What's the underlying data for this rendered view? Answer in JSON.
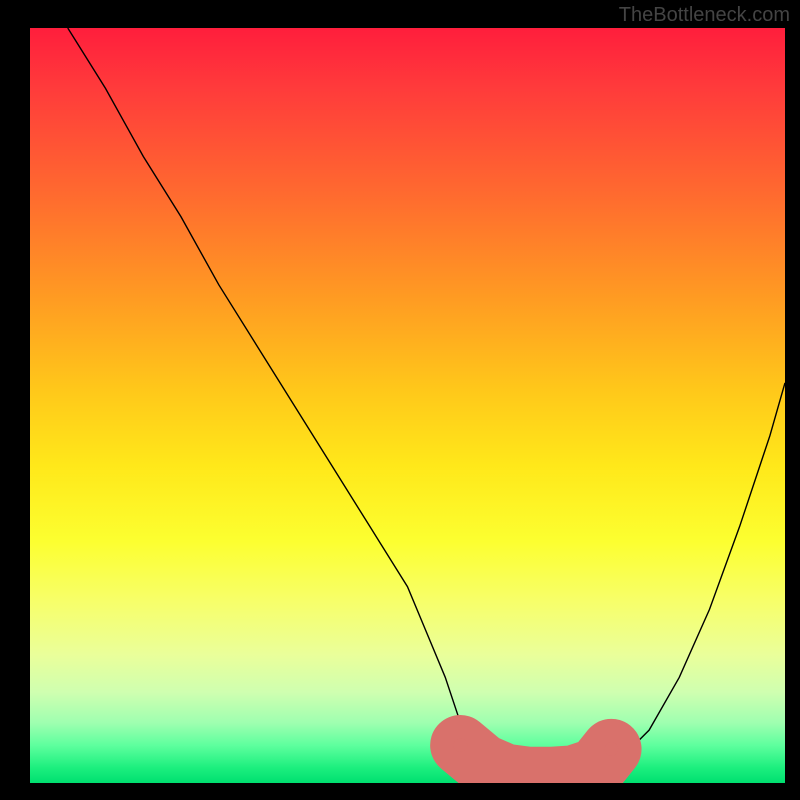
{
  "watermark": "TheBottleneck.com",
  "chart_data": {
    "type": "line",
    "title": "",
    "xlabel": "",
    "ylabel": "",
    "xlim": [
      0,
      100
    ],
    "ylim": [
      0,
      100
    ],
    "grid": false,
    "legend": false,
    "series": [
      {
        "name": "bottleneck-curve",
        "stroke": "#000000",
        "x": [
          5,
          10,
          15,
          20,
          25,
          30,
          35,
          40,
          45,
          50,
          55,
          57,
          60,
          63,
          66,
          69,
          72,
          75,
          78,
          82,
          86,
          90,
          94,
          98,
          100
        ],
        "y": [
          100,
          92,
          83,
          75,
          66,
          58,
          50,
          42,
          34,
          26,
          14,
          8,
          4,
          2,
          1,
          0.5,
          0.5,
          1,
          3,
          7,
          14,
          23,
          34,
          46,
          53
        ]
      },
      {
        "name": "optimal-range",
        "stroke": "#d9716b",
        "x": [
          57,
          60,
          63,
          66,
          69,
          72,
          75,
          77
        ],
        "y": [
          5,
          2.5,
          1.2,
          0.8,
          0.8,
          1.0,
          2.0,
          4.5
        ]
      }
    ],
    "markers": [
      {
        "name": "optimal-start-dot",
        "x": 57,
        "y": 5,
        "color": "#d9716b"
      },
      {
        "name": "optimal-end-dot",
        "x": 77,
        "y": 4.5,
        "color": "#d9716b"
      }
    ],
    "gradient_stops": [
      {
        "pct": 0,
        "color": "#ff1e3c"
      },
      {
        "pct": 50,
        "color": "#ffe81a"
      },
      {
        "pct": 100,
        "color": "#00e070"
      }
    ]
  }
}
